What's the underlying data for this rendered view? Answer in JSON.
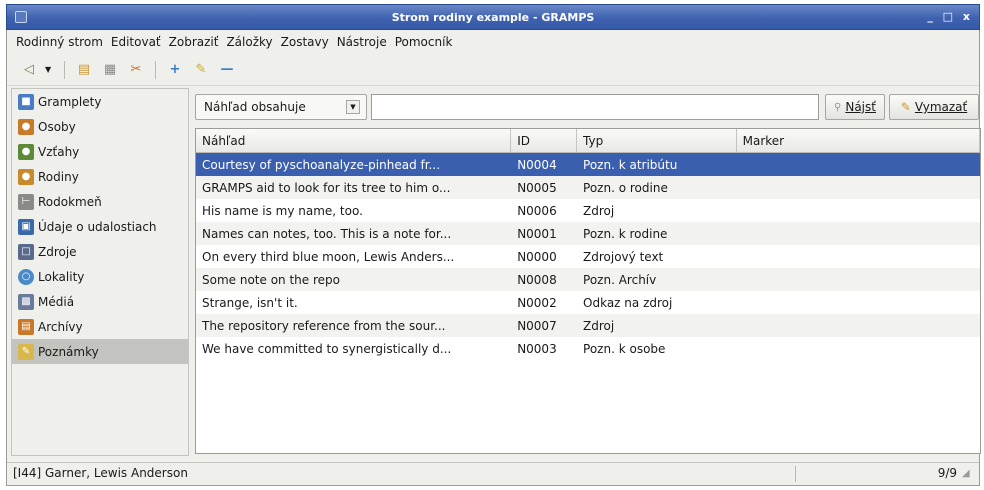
{
  "window": {
    "title": "Strom rodiny example - GRAMPS",
    "controls": "_ □ x"
  },
  "menubar": {
    "items": [
      "Rodinný strom",
      "Editovať",
      "Zobraziť",
      "Záložky",
      "Zostavy",
      "Nástroje",
      "Pomocník"
    ]
  },
  "toolbar": {
    "buttons": [
      "back-icon",
      "clipboard-icon",
      "view-icon",
      "cut-icon",
      "add-icon",
      "edit-icon",
      "remove-icon"
    ]
  },
  "sidebar": {
    "items": [
      {
        "label": "Gramplety",
        "icon": "gramplets-icon",
        "color": "#4a7cc4"
      },
      {
        "label": "Osoby",
        "icon": "people-icon",
        "color": "#c87a2a"
      },
      {
        "label": "Vzťahy",
        "icon": "relationships-icon",
        "color": "#5a8a3a"
      },
      {
        "label": "Rodiny",
        "icon": "families-icon",
        "color": "#c88a2a"
      },
      {
        "label": "Rodokmeň",
        "icon": "pedigree-icon",
        "color": "#8a8a86"
      },
      {
        "label": "Údaje o udalostiach",
        "icon": "events-icon",
        "color": "#3a6aa8"
      },
      {
        "label": "Zdroje",
        "icon": "sources-icon",
        "color": "#5a6a8a"
      },
      {
        "label": "Lokality",
        "icon": "places-icon",
        "color": "#4a8ac8"
      },
      {
        "label": "Médiá",
        "icon": "media-icon",
        "color": "#6a7a9a"
      },
      {
        "label": "Archívy",
        "icon": "repositories-icon",
        "color": "#c8782a"
      },
      {
        "label": "Poznámky",
        "icon": "notes-icon",
        "color": "#d8b84a"
      }
    ],
    "active_index": 10
  },
  "filter": {
    "combo_value": "Náhľad obsahuje",
    "search_value": "",
    "find_label": "Nájsť",
    "clear_label": "Vymazať"
  },
  "list": {
    "columns": [
      "Náhľad",
      "ID",
      "Typ",
      "Marker"
    ],
    "rows": [
      {
        "preview": "Courtesy of pyschoanalyze-pinhead fr...",
        "id": "N0004",
        "type": "Pozn. k atribútu",
        "marker": ""
      },
      {
        "preview": "GRAMPS aid to look for its tree to him o...",
        "id": "N0005",
        "type": "Pozn. o rodine",
        "marker": ""
      },
      {
        "preview": "His name is my name, too.",
        "id": "N0006",
        "type": "Zdroj",
        "marker": ""
      },
      {
        "preview": "Names can notes, too. This is a note for...",
        "id": "N0001",
        "type": "Pozn. k rodine",
        "marker": ""
      },
      {
        "preview": "On every third blue moon, Lewis Anders...",
        "id": "N0000",
        "type": "Zdrojový text",
        "marker": ""
      },
      {
        "preview": "Some note on the repo",
        "id": "N0008",
        "type": "Pozn. Archív",
        "marker": ""
      },
      {
        "preview": "Strange, isn't it.",
        "id": "N0002",
        "type": "Odkaz na zdroj",
        "marker": ""
      },
      {
        "preview": "The repository reference from the sour...",
        "id": "N0007",
        "type": "Zdroj",
        "marker": ""
      },
      {
        "preview": "We have committed to synergistically d...",
        "id": "N0003",
        "type": "Pozn. k osobe",
        "marker": ""
      }
    ],
    "selected_index": 0
  },
  "status": {
    "text": "[I44] Garner, Lewis Anderson",
    "count": "9/9"
  }
}
